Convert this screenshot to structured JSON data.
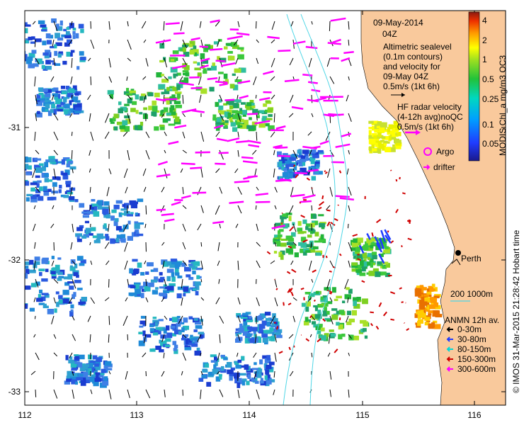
{
  "date_title": "09-May-2014",
  "time_title": "04Z",
  "altimetry_text": [
    "Altimetric sealevel",
    "(0.1m contours)",
    "and velocity for",
    "09-May 04Z",
    "0.5m/s (1kt 6h)"
  ],
  "hf_radar_text": [
    "HF radar velocity",
    "(4-12h avg)noQC",
    "0.5m/s (1kt 6h)"
  ],
  "argo_label": "Argo",
  "drifter_label": "drifter",
  "city_label": "Perth",
  "bathymetry_label": "200  1000m",
  "anmn_title": "ANMN 12h av.",
  "anmn_items": [
    {
      "label": "0-30m",
      "color": "#000000"
    },
    {
      "label": "30-80m",
      "color": "#1f3cff"
    },
    {
      "label": "80-150m",
      "color": "#00d8d8"
    },
    {
      "label": "150-300m",
      "color": "#d00000"
    },
    {
      "label": "300-600m",
      "color": "#ff00ff"
    }
  ],
  "colorbar_title": "MODIS Chl_a mg/m3 OC3",
  "colorbar_ticks": [
    "4",
    "2",
    "1",
    "0.5",
    "0.25",
    "0.1",
    "0.05"
  ],
  "credit": "© IMOS 31-Mar-2015 21:28:42 Hobart time",
  "x_ticks": [
    "112",
    "113",
    "114",
    "115",
    "116"
  ],
  "y_ticks": [
    "-31",
    "-32",
    "-33"
  ],
  "colors": {
    "land": "#f9c99c",
    "ocean": "#ffffff",
    "altimetry_arrows": "#000000",
    "hf_radar_arrows": "#ff00ff",
    "anmn_150_300": "#d00000"
  }
}
